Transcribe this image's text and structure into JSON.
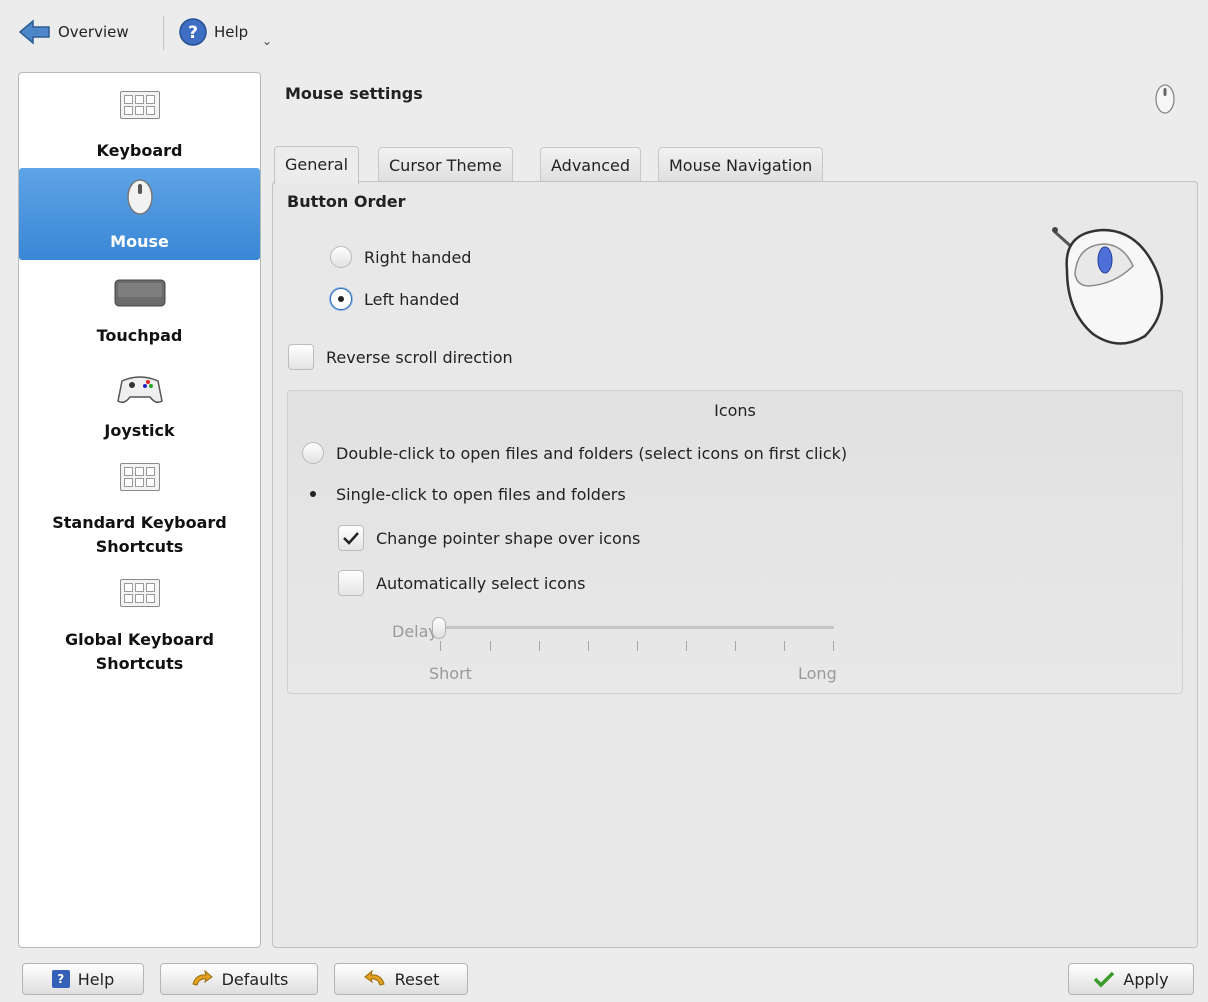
{
  "toolbar": {
    "overview_label": "Overview",
    "help_label": "Help"
  },
  "sidebar": {
    "items": [
      {
        "label": "Keyboard",
        "icon": "keyboard-icon"
      },
      {
        "label": "Mouse",
        "icon": "mouse-icon",
        "selected": true
      },
      {
        "label": "Touchpad",
        "icon": "touchpad-icon"
      },
      {
        "label": "Joystick",
        "icon": "joystick-icon"
      },
      {
        "label": "Standard Keyboard Shortcuts",
        "icon": "keyboard-icon"
      },
      {
        "label": "Global Keyboard Shortcuts",
        "icon": "keyboard-icon"
      }
    ]
  },
  "main": {
    "title": "Mouse settings",
    "tabs": [
      {
        "label": "General",
        "active": true
      },
      {
        "label": "Cursor Theme"
      },
      {
        "label": "Advanced"
      },
      {
        "label": "Mouse Navigation"
      }
    ],
    "button_order": {
      "title": "Button Order",
      "right_handed": "Right handed",
      "left_handed": "Left handed",
      "selected": "left_handed"
    },
    "reverse_scroll": {
      "label": "Reverse scroll direction",
      "checked": false
    },
    "icons_group": {
      "title": "Icons",
      "double_click": "Double-click to open files and folders (select icons on first click)",
      "single_click": "Single-click to open files and folders",
      "selected": "single_click",
      "change_pointer": {
        "label": "Change pointer shape over icons",
        "checked": true
      },
      "auto_select": {
        "label": "Automatically select icons",
        "checked": false
      },
      "delay": {
        "label": "Delay:",
        "min_label": "Short",
        "max_label": "Long",
        "value_fraction": 0
      }
    }
  },
  "buttons": {
    "help": "Help",
    "defaults": "Defaults",
    "reset": "Reset",
    "apply": "Apply"
  },
  "colors": {
    "selection": "#3a87d6",
    "accent_radio": "#2d6ab8",
    "apply_check": "#3a9a2a"
  }
}
